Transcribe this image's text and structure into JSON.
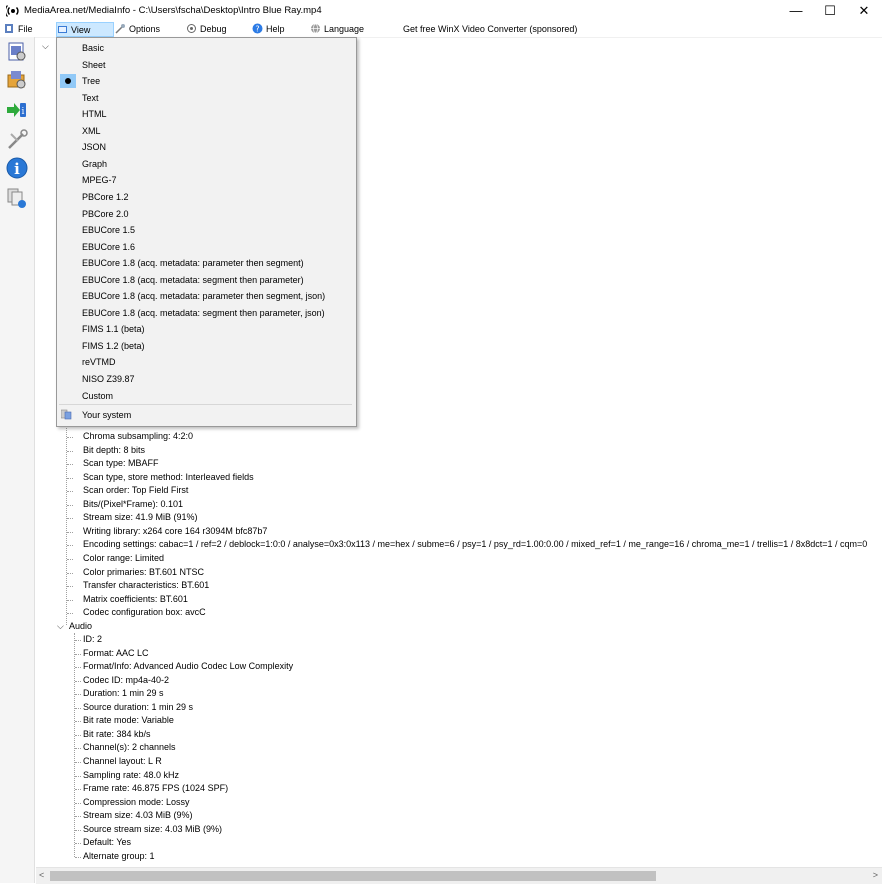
{
  "window": {
    "title": "MediaArea.net/MediaInfo - C:\\Users\\fscha\\Desktop\\Intro Blue Ray.mp4",
    "controls": [
      "—",
      "☐",
      "✕"
    ]
  },
  "menubar": {
    "file": "File",
    "view": "View",
    "options": "Options",
    "debug": "Debug",
    "help": "Help",
    "language": "Language",
    "sponsored": "Get free WinX Video Converter (sponsored)"
  },
  "view_menu": {
    "items": [
      "Basic",
      "Sheet",
      "Tree",
      "Text",
      "HTML",
      "XML",
      "JSON",
      "Graph",
      "MPEG-7",
      "PBCore 1.2",
      "PBCore 2.0",
      "EBUCore 1.5",
      "EBUCore 1.6",
      "EBUCore 1.8 (acq. metadata: parameter then segment)",
      "EBUCore 1.8 (acq. metadata: segment then parameter)",
      "EBUCore 1.8 (acq. metadata: parameter then segment, json)",
      "EBUCore 1.8 (acq. metadata: segment then parameter, json)",
      "FIMS 1.1 (beta)",
      "FIMS 1.2 (beta)",
      "reVTMD",
      "NISO Z39.87",
      "Custom"
    ],
    "selected": "Tree",
    "your_system": "Your system"
  },
  "tree": {
    "video_tail": [
      "Chroma subsampling: 4:2:0",
      "Bit depth: 8 bits",
      "Scan type: MBAFF",
      "Scan type, store method: Interleaved fields",
      "Scan order: Top Field First",
      "Bits/(Pixel*Frame): 0.101",
      "Stream size: 41.9 MiB (91%)",
      "Writing library: x264 core 164 r3094M bfc87b7",
      "Encoding settings: cabac=1 / ref=2 / deblock=1:0:0 / analyse=0x3:0x113 / me=hex / subme=6 / psy=1 / psy_rd=1.00:0.00 / mixed_ref=1 / me_range=16 / chroma_me=1 / trellis=1 / 8x8dct=1 / cqm=0",
      "Color range: Limited",
      "Color primaries: BT.601 NTSC",
      "Transfer characteristics: BT.601",
      "Matrix coefficients: BT.601",
      "Codec configuration box: avcC"
    ],
    "audio_label": "Audio",
    "audio": [
      "ID: 2",
      "Format: AAC LC",
      "Format/Info: Advanced Audio Codec Low Complexity",
      "Codec ID: mp4a-40-2",
      "Duration: 1 min 29 s",
      "Source duration: 1 min 29 s",
      "Bit rate mode: Variable",
      "Bit rate: 384 kb/s",
      "Channel(s): 2 channels",
      "Channel layout: L R",
      "Sampling rate: 48.0 kHz",
      "Frame rate: 46.875 FPS (1024 SPF)",
      "Compression mode: Lossy",
      "Stream size: 4.03 MiB (9%)",
      "Source stream size: 4.03 MiB (9%)",
      "Default: Yes",
      "Alternate group: 1"
    ]
  },
  "icons": {
    "app": "mediainfo-logo-icon",
    "toolbar": [
      "open-file-icon",
      "open-folder-icon",
      "export-icon",
      "preferences-icon",
      "about-icon",
      "knowledge-base-icon"
    ]
  },
  "colors": {
    "menu_highlight": "#cce8ff",
    "check_bg": "#91c9f7",
    "dropdown_bg": "#f2f2f2"
  }
}
